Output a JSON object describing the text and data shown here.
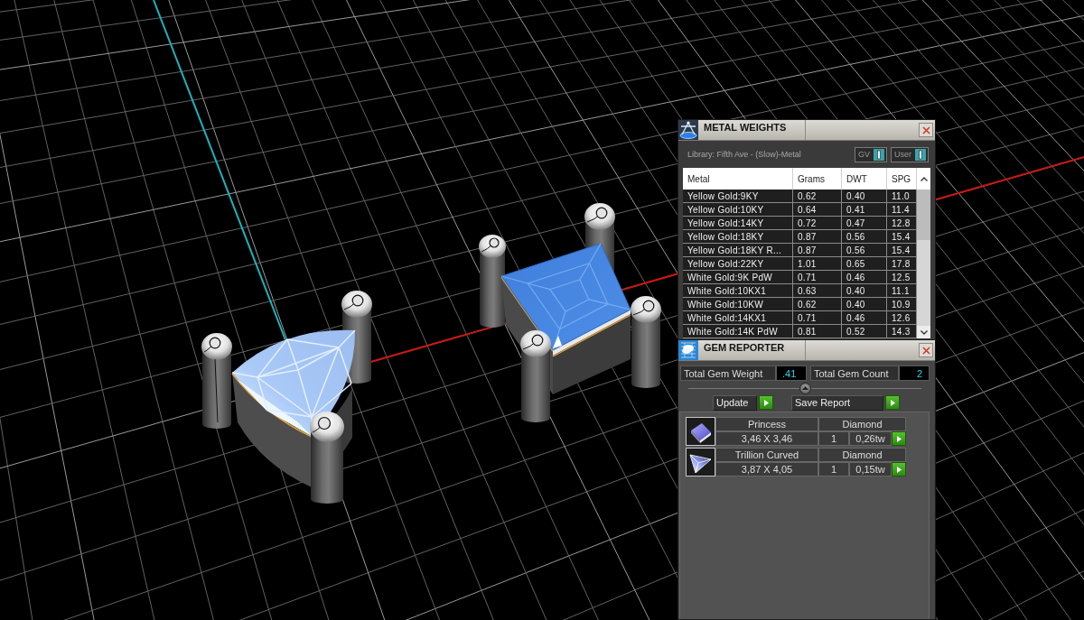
{
  "metal_weights": {
    "title": "METAL WEIGHTS",
    "library": "Library: Fifth Ave - (Slow)-Metal",
    "toggles": [
      {
        "label": "GV",
        "on": true
      },
      {
        "label": "User",
        "on": true
      }
    ],
    "table": {
      "columns": [
        "Metal",
        "Grams",
        "DWT",
        "SPG"
      ],
      "rows": [
        [
          "Yellow Gold:9KY",
          "0.62",
          "0.40",
          "11.0"
        ],
        [
          "Yellow Gold:10KY",
          "0.64",
          "0.41",
          "11.4"
        ],
        [
          "Yellow Gold:14KY",
          "0.72",
          "0.47",
          "12.8"
        ],
        [
          "Yellow Gold:18KY",
          "0.87",
          "0.56",
          "15.4"
        ],
        [
          "Yellow Gold:18KY R...",
          "0.87",
          "0.56",
          "15.4"
        ],
        [
          "Yellow Gold:22KY",
          "1.01",
          "0.65",
          "17.8"
        ],
        [
          "White Gold:9K PdW",
          "0.71",
          "0.46",
          "12.5"
        ],
        [
          "White Gold:10KX1",
          "0.63",
          "0.40",
          "11.1"
        ],
        [
          "White Gold:10KW",
          "0.62",
          "0.40",
          "10.9"
        ],
        [
          "White Gold:14KX1",
          "0.71",
          "0.46",
          "12.6"
        ],
        [
          "White Gold:14K PdW",
          "0.81",
          "0.52",
          "14.3"
        ]
      ]
    }
  },
  "gem_reporter": {
    "title": "GEM REPORTER",
    "totals": [
      {
        "label": "Total Gem Weight",
        "value": ".41"
      },
      {
        "label": "Total Gem Count",
        "value": "2"
      }
    ],
    "buttons": [
      "Update",
      "Save Report"
    ],
    "gems": [
      {
        "kind": "princess",
        "name": "Princess",
        "material": "Diamond",
        "size": "3,46 X 3,46",
        "count": "1",
        "weight": "0,26tw"
      },
      {
        "kind": "trillion",
        "name": "Trillion Curved",
        "material": "Diamond",
        "size": "3,87 X 4,05",
        "count": "1",
        "weight": "0,15tw"
      }
    ]
  }
}
